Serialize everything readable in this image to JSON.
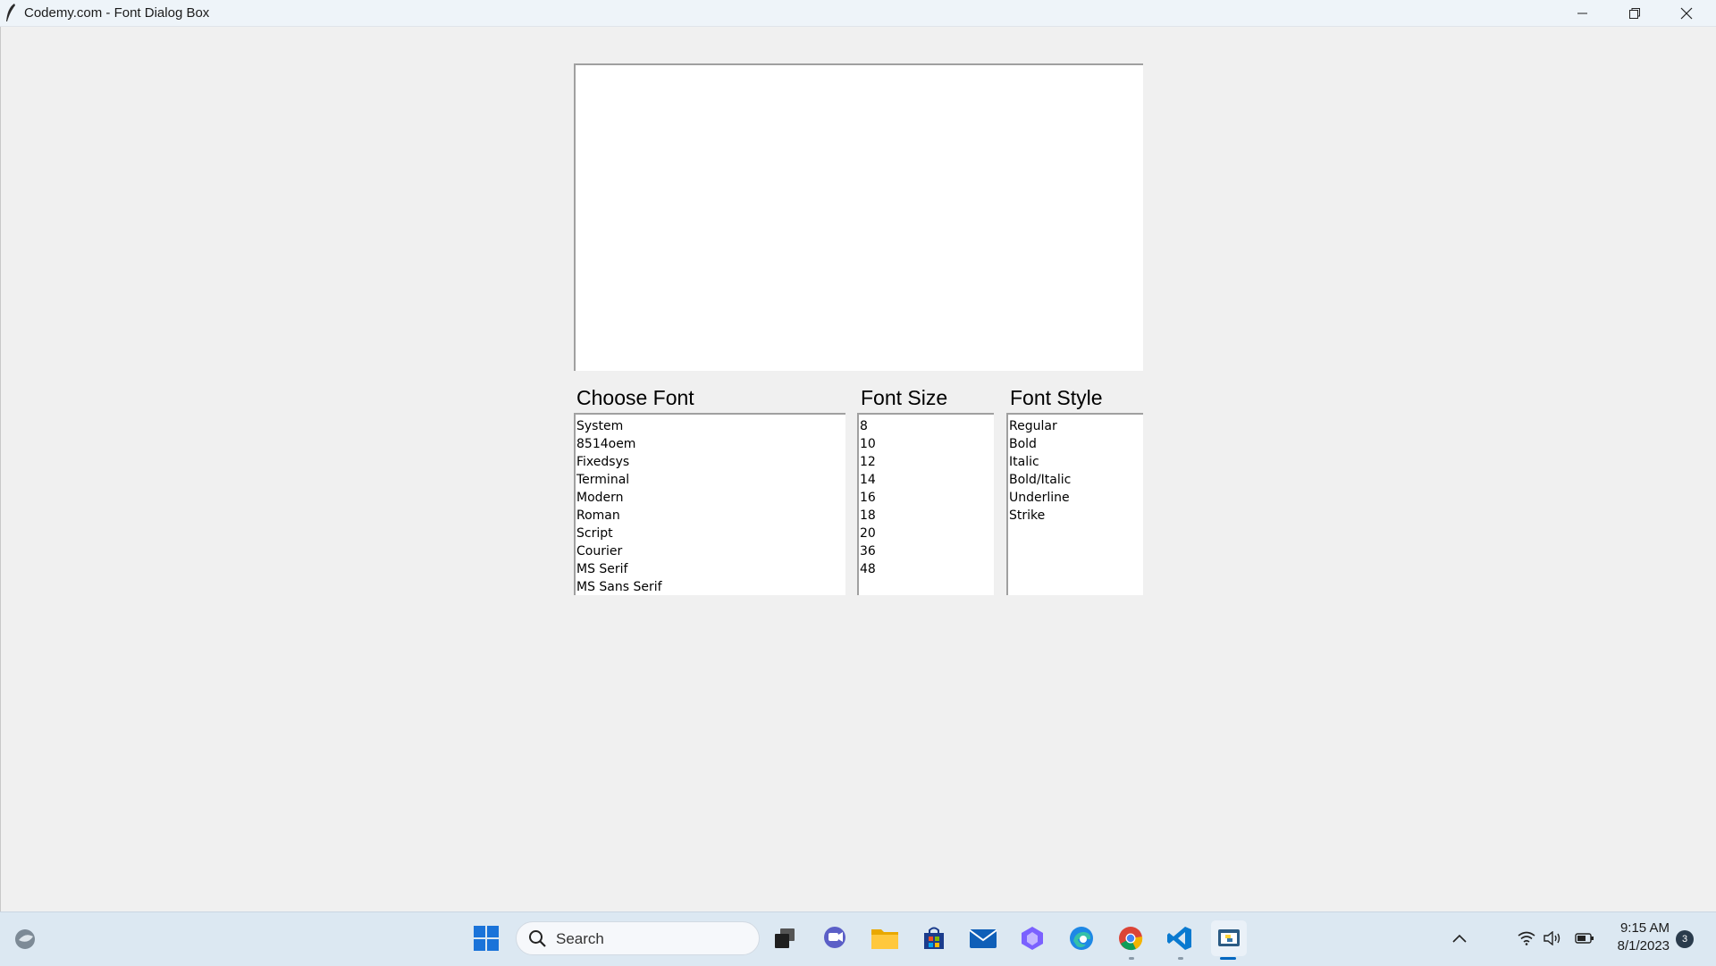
{
  "window": {
    "title": "Codemy.com - Font Dialog Box",
    "controls": {
      "minimize": "minimize-icon",
      "maximize": "restore-icon",
      "close": "close-icon"
    }
  },
  "main": {
    "preview_text": "",
    "font_label": "Choose Font",
    "size_label": "Font Size",
    "style_label": "Font Style",
    "fonts": [
      "System",
      "8514oem",
      "Fixedsys",
      "Terminal",
      "Modern",
      "Roman",
      "Script",
      "Courier",
      "MS Serif",
      "MS Sans Serif"
    ],
    "sizes": [
      "8",
      "10",
      "12",
      "14",
      "16",
      "18",
      "20",
      "36",
      "48"
    ],
    "styles": [
      "Regular",
      "Bold",
      "Italic",
      "Bold/Italic",
      "Underline",
      "Strike"
    ]
  },
  "taskbar": {
    "search_placeholder": "Search",
    "time": "9:15 AM",
    "date": "8/1/2023",
    "notification_count": "3",
    "apps": [
      "widgets-icon",
      "start-icon",
      "task-view-icon",
      "teams-chat-icon",
      "file-explorer-icon",
      "store-icon",
      "mail-icon",
      "copilot-icon",
      "edge-icon",
      "chrome-icon",
      "vscode-icon",
      "python-app-icon"
    ],
    "tray": [
      "chevron-up-icon",
      "wifi-icon",
      "volume-icon",
      "battery-icon"
    ]
  },
  "colors": {
    "accent": "#0067c0",
    "taskbar": "#dce8f2",
    "window_bg": "#f0f0f0"
  }
}
